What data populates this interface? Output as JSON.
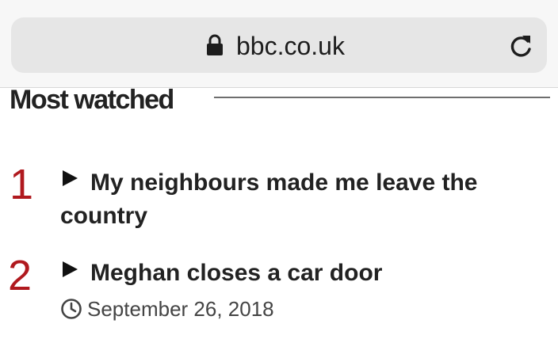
{
  "browser": {
    "url": "bbc.co.uk",
    "lock_icon": "lock-icon",
    "reload_icon": "reload-icon"
  },
  "section": {
    "title": "Most watched"
  },
  "items": [
    {
      "rank": "1",
      "headline_line1": "My neighbours made me leave the",
      "headline_line2": "country",
      "icon": "play-icon"
    },
    {
      "rank": "2",
      "headline": "Meghan closes a car door",
      "icon": "play-icon",
      "date": "September 26, 2018",
      "date_icon": "clock-icon"
    }
  ],
  "colors": {
    "rank": "#b0191e",
    "text": "#222222",
    "url_field": "#e6e6e6"
  }
}
